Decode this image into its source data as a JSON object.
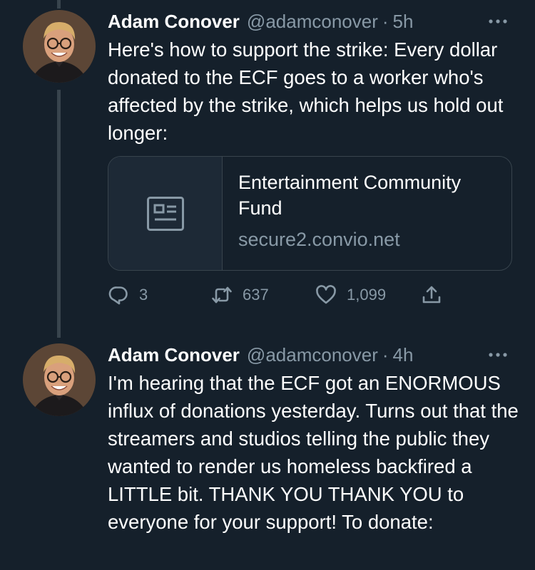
{
  "tweets": [
    {
      "author_name": "Adam Conover",
      "author_handle": "@adamconover",
      "separator": "·",
      "time": "5h",
      "text": "Here's how to support the strike: Every dollar donated to the ECF goes to a worker who's affected by the strike, which helps us hold out longer:",
      "link_card": {
        "title": "Entertainment Community Fund",
        "domain": "secure2.convio.net",
        "thumbnail_icon": "article-icon"
      },
      "actions": {
        "replies": "3",
        "retweets": "637",
        "likes": "1,099"
      }
    },
    {
      "author_name": "Adam Conover",
      "author_handle": "@adamconover",
      "separator": "·",
      "time": "4h",
      "text": "I'm hearing that the ECF got an ENORMOUS influx of donations yesterday. Turns out that the streamers and studios telling the public they wanted to render us homeless backfired a LITTLE bit. THANK YOU THANK YOU to everyone for your support! To donate:"
    }
  ],
  "icons": {
    "more": "more-icon",
    "reply": "reply-icon",
    "retweet": "retweet-icon",
    "like": "heart-icon",
    "share": "share-icon"
  },
  "colors": {
    "background": "#15202b",
    "text": "#ffffff",
    "secondary_text": "#8899a6",
    "border": "#38444d"
  }
}
